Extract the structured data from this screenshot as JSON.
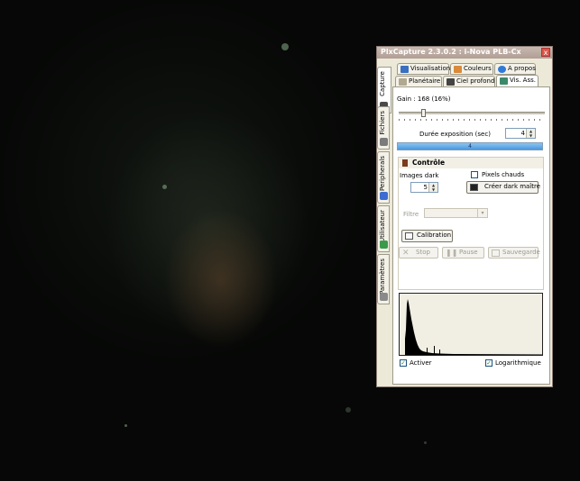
{
  "window": {
    "title": "PlxCapture 2.3.0.2 : i-Nova PLB-Cx",
    "close_glyph": "x"
  },
  "side_tabs": [
    {
      "label": "Capture",
      "icon": "camera-icon"
    },
    {
      "label": "Fichiers",
      "icon": "files-icon"
    },
    {
      "label": "Peripherals",
      "icon": "peripherals-icon"
    },
    {
      "label": "Utilisateur",
      "icon": "user-icon"
    },
    {
      "label": "Paramètres",
      "icon": "tools-icon"
    }
  ],
  "top_tabs_row1": [
    {
      "label": "Visualisation",
      "icon": "monitor-icon"
    },
    {
      "label": "Couleurs",
      "icon": "palette-icon"
    },
    {
      "label": "A propos",
      "icon": "info-icon"
    }
  ],
  "top_tabs_row2": [
    {
      "label": "Planétaire",
      "icon": "planet-icon"
    },
    {
      "label": "Ciel profond",
      "icon": "deep-sky-icon"
    },
    {
      "label": "Vis. Ass.",
      "icon": "screen-icon"
    }
  ],
  "gain": {
    "label": "Gain : 168 (16%)",
    "level_fraction": 0.16
  },
  "exposure": {
    "label": "Durée exposition (sec)",
    "value": "4",
    "progress_text": "4",
    "progress_fraction": 1.0
  },
  "control": {
    "header": "Contrôle"
  },
  "dark": {
    "images_label": "Images dark",
    "images_value": "5",
    "hot_pixels_label": "Pixels chauds",
    "create_master_label": "Créer dark maître"
  },
  "filter": {
    "label": "Filtre",
    "value": ""
  },
  "calibration_label": "Calibration",
  "actions": {
    "stop": "Stop",
    "pause": "Pause",
    "save": "Sauvegarde"
  },
  "histogram": {
    "activate_label": "Activer",
    "activate_checked": true,
    "log_label": "Logarithmique",
    "log_checked": true
  },
  "colors": {
    "accent": "#5aa9e6",
    "title_bar": "#b9a8a0",
    "panel": "#ece9d8"
  }
}
